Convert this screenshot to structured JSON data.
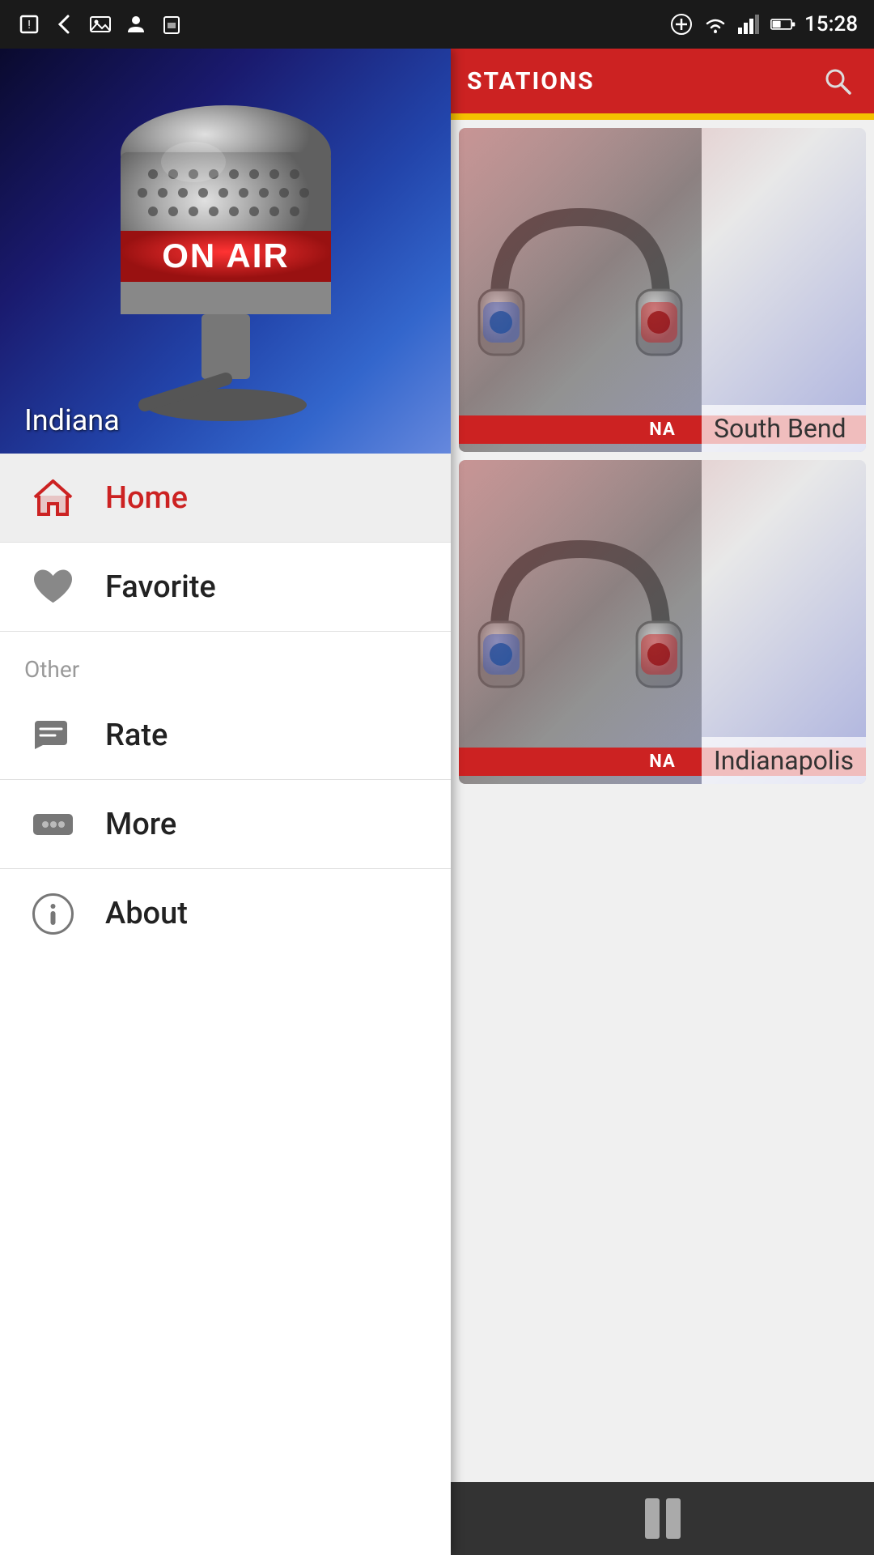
{
  "statusBar": {
    "time": "15:28",
    "battery": "42%"
  },
  "hero": {
    "locationLabel": "Indiana",
    "altText": "On Air Microphone"
  },
  "nav": {
    "homeLabel": "Home",
    "favoriteLabel": "Favorite",
    "otherSectionLabel": "Other",
    "rateLabel": "Rate",
    "moreLabel": "More",
    "aboutLabel": "About"
  },
  "rightPanel": {
    "title": "STATIONS",
    "searchIconLabel": "search"
  },
  "stations": [
    {
      "name": "South Bend",
      "badge": "NA"
    },
    {
      "name": "Indianapolis",
      "badge": "NA"
    }
  ],
  "player": {
    "pauseLabel": "pause"
  }
}
